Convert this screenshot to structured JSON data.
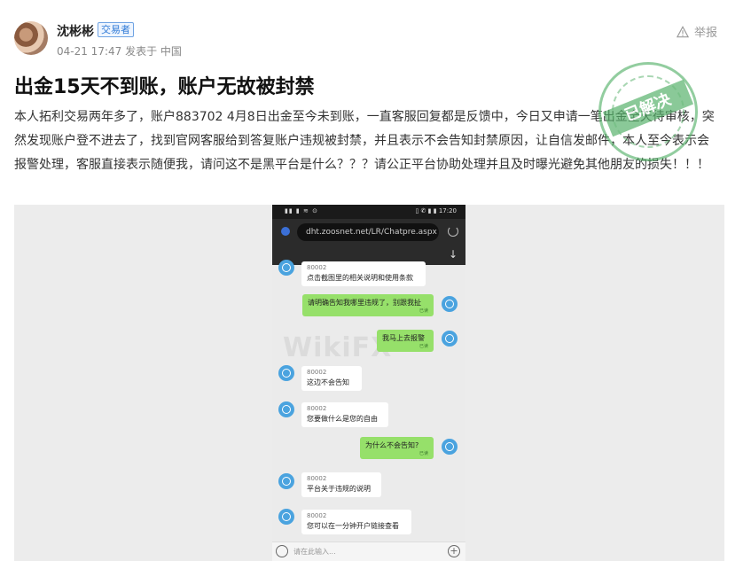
{
  "header": {
    "user_name": "沈彬彬",
    "user_tag": "交易者",
    "post_meta": "04-21 17:47 发表于 中国",
    "report_label": "举报"
  },
  "post": {
    "title": "出金15天不到账，账户无故被封禁",
    "body": "本人拓利交易两年多了，账户883702 4月8日出金至今未到账，一直客服回复都是反馈中，今日又申请一笔出金全天待审核，突然发现账户登不进去了，找到官网客服给到答复账户违规被封禁，并且表示不会告知封禁原因，让自信发邮件，本人至今表示会报警处理，客服直接表示随便我，请问这不是黑平台是什么？？？请公正平台协助处理并且及时曝光避免其他朋友的损失！！！"
  },
  "seal": {
    "text": "已解决"
  },
  "screenshot": {
    "status_left": "▮▮ ▮ ≋ ⊙",
    "status_right": "▯ ✆ ▮ ▮ 17:20",
    "url": "dht.zoosnet.net/LR/Chatpre.aspx",
    "watermark": "WikiFX",
    "input_placeholder": "请在此输入...",
    "messages": [
      {
        "side": "left",
        "sender": "80002",
        "text": "点击截图里的相关说明和使用条款"
      },
      {
        "side": "right",
        "text": "请明确告知我哪里违规了，别跟我扯",
        "read": "已读"
      },
      {
        "side": "right",
        "text": "我马上去报警",
        "read": "已读"
      },
      {
        "side": "left",
        "sender": "80002",
        "text": "这边不会告知"
      },
      {
        "side": "left",
        "sender": "80002",
        "text": "您要做什么是您的自由"
      },
      {
        "side": "right",
        "text": "为什么不会告知?",
        "read": "已读"
      },
      {
        "side": "left",
        "sender": "80002",
        "text": "平台关于违规的说明"
      },
      {
        "side": "left",
        "sender": "80002",
        "text": "您可以在一分钟开户链接查看"
      }
    ]
  }
}
